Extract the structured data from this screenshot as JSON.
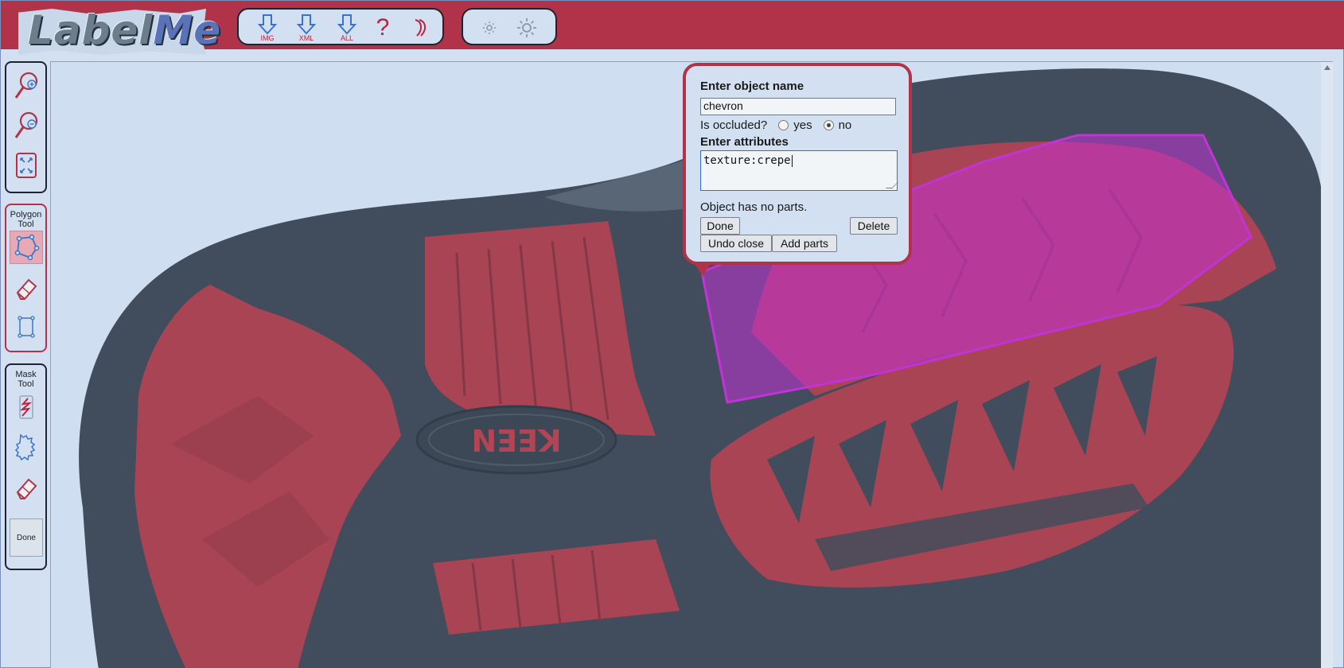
{
  "header": {
    "logo_text": "LabelMe",
    "toolbar": {
      "download_img_label": "IMG",
      "download_xml_label": "XML",
      "download_all_label": "ALL",
      "help_label": "?"
    }
  },
  "sidebar": {
    "polygon_tool_title": "Polygon Tool",
    "mask_tool_title": "Mask Tool",
    "mask_done_label": "Done"
  },
  "popup": {
    "name_heading": "Enter object name",
    "name_value": "chevron",
    "occluded_label": "Is occluded?",
    "occluded_yes": "yes",
    "occluded_no": "no",
    "occluded_selected": "no",
    "attributes_heading": "Enter attributes",
    "attributes_value": "texture:crepe",
    "no_parts_text": "Object has no parts.",
    "done_label": "Done",
    "delete_label": "Delete",
    "undo_close_label": "Undo close",
    "add_parts_label": "Add parts"
  },
  "image": {
    "brand_text": "KEEN"
  },
  "colors": {
    "header": "#b0334a",
    "background": "#d2e0f2",
    "polygon": "#c233d6",
    "accent": "#c0203a"
  }
}
